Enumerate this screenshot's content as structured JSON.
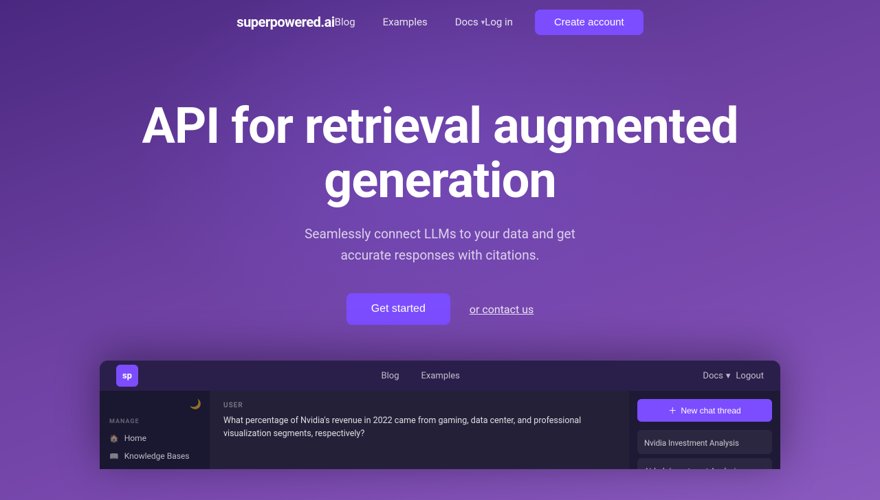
{
  "nav": {
    "logo": "superpowered.ai",
    "links": [
      {
        "id": "blog",
        "label": "Blog"
      },
      {
        "id": "examples",
        "label": "Examples"
      },
      {
        "id": "docs",
        "label": "Docs"
      }
    ],
    "login_label": "Log in",
    "create_account_label": "Create account"
  },
  "hero": {
    "title_line1": "API for retrieval augmented",
    "title_line2": "generation",
    "subtitle": "Seamlessly connect LLMs to your data and get\naccurate responses with citations.",
    "cta_label": "Get started",
    "contact_label": "or contact us"
  },
  "app_demo": {
    "nav": {
      "logo_text": "sp",
      "links": [
        "Blog",
        "Examples"
      ],
      "docs_label": "Docs",
      "logout_label": "Logout"
    },
    "sidebar": {
      "manage_label": "MANAGE",
      "items": [
        {
          "label": "Home",
          "icon": "🏠"
        },
        {
          "label": "Knowledge Bases",
          "icon": "📖"
        }
      ]
    },
    "chat": {
      "user_label": "USER",
      "message": "What percentage of Nvidia's revenue in 2022 came from gaming, data center, and professional visualization segments, respectively?"
    },
    "right_panel": {
      "new_chat_btn": "New chat thread",
      "threads": [
        {
          "name": "Nvidia Investment Analysis"
        },
        {
          "name": "Airbnb Investment Analysis"
        }
      ]
    }
  }
}
